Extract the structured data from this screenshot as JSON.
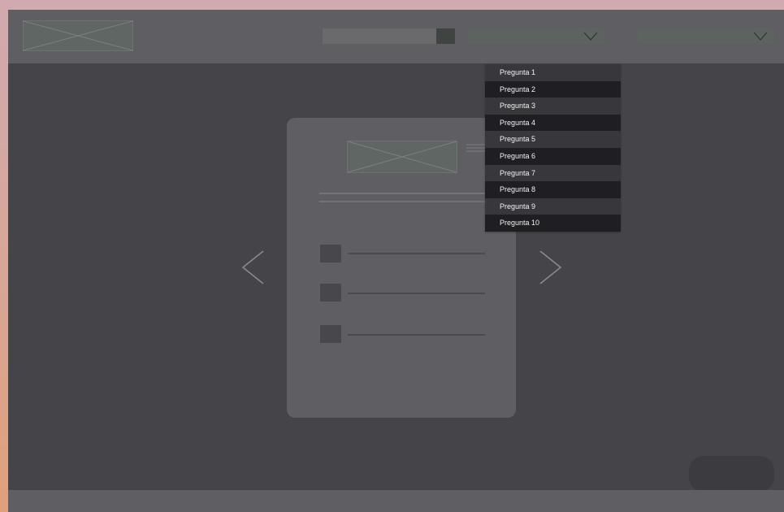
{
  "colors": {
    "backdrop_top": "#d1a9b0",
    "backdrop_bottom": "#e0a07c",
    "frame_background": "#454448",
    "topbar_background": "#5f5e62",
    "card_background": "#5f5e62",
    "dropdown_row_dark": "#1f1e22",
    "dropdown_row_light": "#38373b",
    "dropdown_text": "#f2f2f2"
  },
  "header": {
    "logo_icon": "image-placeholder-icon",
    "search_icon": "search-button",
    "select_1_icon": "chevron-down-icon",
    "select_2_icon": "chevron-down-icon"
  },
  "dropdown": {
    "items": [
      "Pregunta 1",
      "Pregunta 2",
      "Pregunta 3",
      "Pregunta 4",
      "Pregunta 5",
      "Pregunta 6",
      "Pregunta 7",
      "Pregunta 8",
      "Pregunta 9",
      "Pregunta 10"
    ]
  },
  "card": {
    "image_icon": "image-placeholder-icon",
    "menu_icon": "hamburger-icon",
    "option_count_icons": [
      "checkbox-icon",
      "checkbox-icon",
      "checkbox-icon"
    ]
  },
  "navigation": {
    "prev_icon": "chevron-left-icon",
    "next_icon": "chevron-right-icon"
  }
}
